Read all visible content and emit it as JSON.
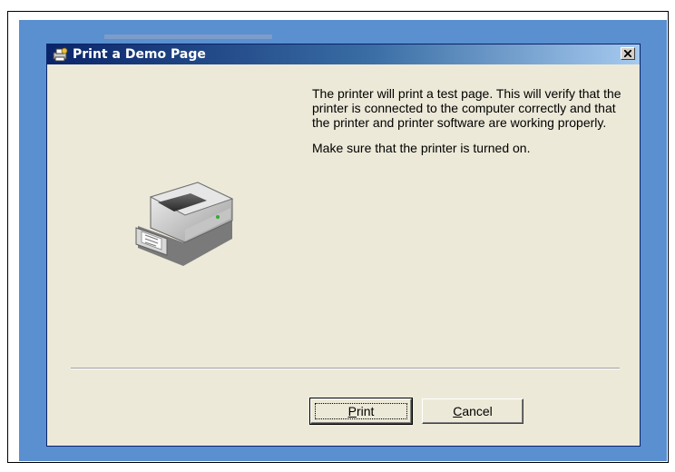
{
  "dialog": {
    "title": "Print a Demo Page",
    "message_paragraphs": [
      "The printer will print a test page. This will verify that the printer is connected to the computer correctly and that the printer and printer software are working properly.",
      "Make sure that the printer is turned on."
    ]
  },
  "buttons": {
    "print": {
      "mnemonic": "P",
      "rest": "rint"
    },
    "cancel": {
      "mnemonic": "C",
      "rest": "ancel"
    }
  },
  "icons": {
    "title": "printer-wizard-icon",
    "close": "close-icon",
    "illustration": "inkjet-printer-illustration"
  },
  "colors": {
    "titlebar_start": "#0a246a",
    "titlebar_end": "#a6caf0",
    "dialog_bg": "#ece9d8",
    "desktop_bg": "#5a8fd0"
  }
}
